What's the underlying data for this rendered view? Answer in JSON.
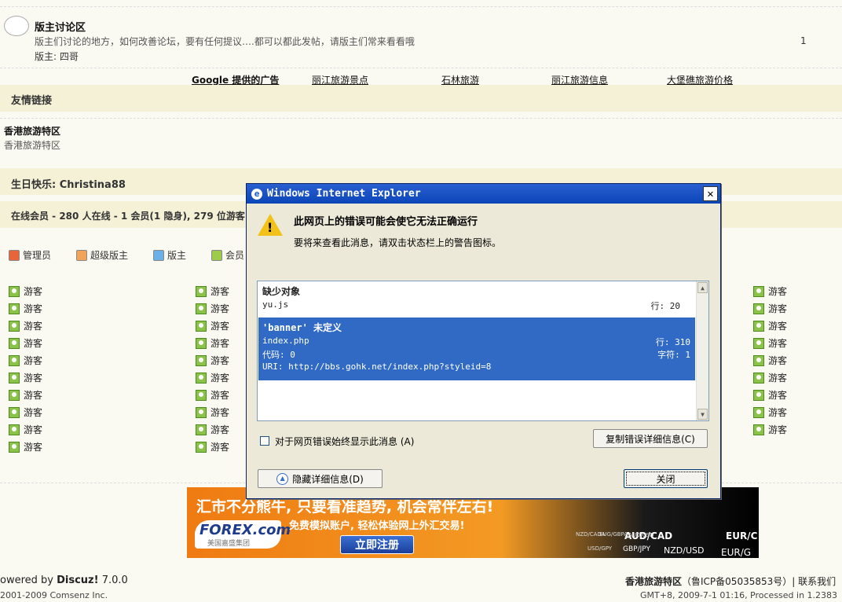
{
  "forum": {
    "name": "版主讨论区",
    "desc": "版主们讨论的地方，如何改善论坛，要有任何提议….都可以都此发帖，请版主们常来看看哦",
    "moderator": "版主: 四哥",
    "count": "1"
  },
  "ad_links": [
    "Google 提供的广告",
    "丽江旅游景点",
    "石林旅游",
    "丽江旅游信息",
    "大堡礁旅游价格"
  ],
  "friends": {
    "title": "友情链接",
    "site_name": "香港旅游特区",
    "site_desc": "香港旅游特区"
  },
  "birthday": {
    "label": "生日快乐: Christina88"
  },
  "online": {
    "label": "在线会员 - 280 人在线 - 1 会员(1 隐身), 279 位游客"
  },
  "legend": [
    "管理员",
    "超级版主",
    "版主",
    "会员"
  ],
  "guest_label": "游客",
  "banner": {
    "headline": "汇市不分熊牛, 只要看准趋势, 机会常伴左右!",
    "logo": "FOREX.com",
    "logo_sub": "美国嘉盛集团",
    "sub": "免费模拟账户, 轻松体验网上外汇交易!",
    "cta": "立即注册",
    "tickers": [
      "AUD/CAD",
      "EUR/C",
      "NZD/USD",
      "EUR/G",
      "GBP/JPY",
      "AUD/USD",
      "USD/GPY",
      "NZD/CADA",
      "EUG/GBPA"
    ]
  },
  "footer": {
    "powered": "owered by ",
    "brand": "Discuz!",
    "version": " 7.0.0",
    "copyright": " 2001-2009 Comsenz Inc.",
    "site": "香港旅游特区",
    "icp": "（鲁ICP备05035853号）",
    "contact": "| 联系我们",
    "time": "GMT+8, 2009-7-1 01:16, Processed in 1.2383"
  },
  "dialog": {
    "title": "Windows Internet Explorer",
    "heading": "此网页上的错误可能会使它无法正确运行",
    "hint": "要将来查看此消息，请双击状态栏上的警告图标。",
    "err1": {
      "title": "缺少对象",
      "file": "yu.js",
      "line": "行: 20"
    },
    "err2": {
      "title": "'banner' 未定义",
      "file": "index.php",
      "line": "行: 310",
      "code": "代码: 0",
      "char": "字符: 1",
      "uri": "URI: http://bbs.gohk.net/index.php?styleid=8"
    },
    "checkbox_label": "对于网页错误始终显示此消息 (A)",
    "copy_button": "复制错误详细信息(C)",
    "hide_button": "隐藏详细信息(D)",
    "close_button": "关闭"
  }
}
